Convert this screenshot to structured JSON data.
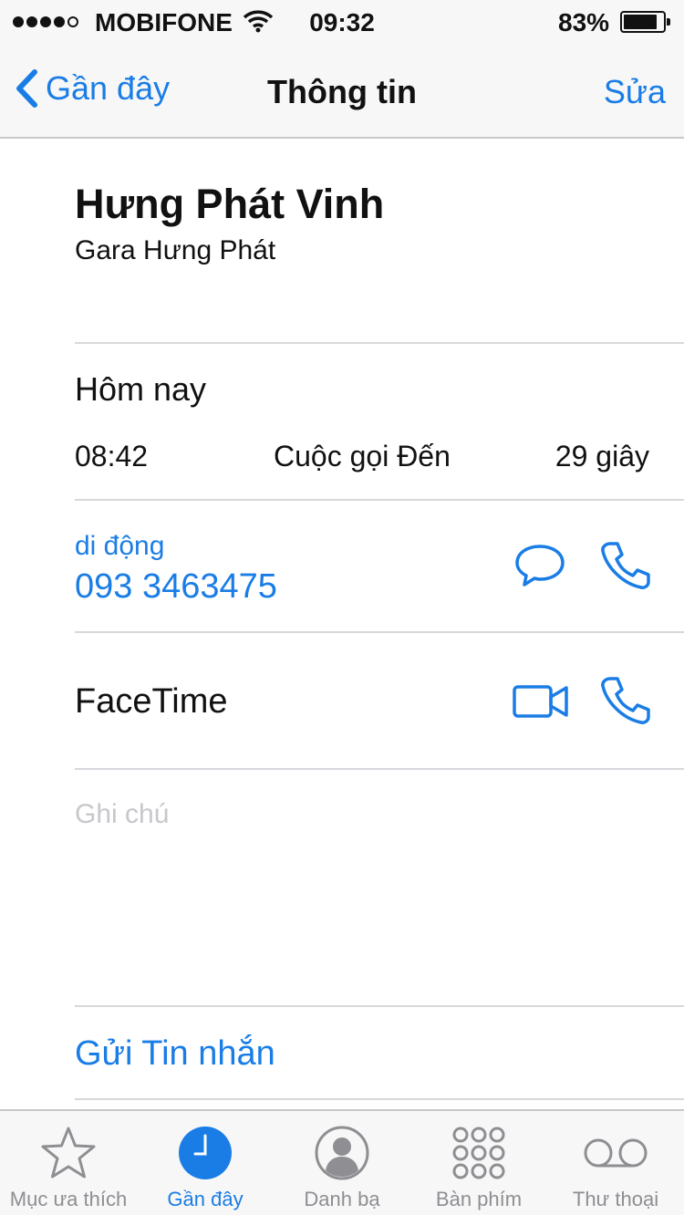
{
  "status_bar": {
    "carrier": "MOBIFONE",
    "time": "09:32",
    "battery_percent": "83%"
  },
  "nav_bar": {
    "back_label": "Gần đây",
    "title": "Thông tin",
    "edit_label": "Sửa"
  },
  "contact": {
    "name": "Hưng Phát Vinh",
    "company": "Gara Hưng Phát"
  },
  "recent_calls": {
    "heading": "Hôm nay",
    "items": [
      {
        "time": "08:42",
        "type": "Cuộc gọi Đến",
        "duration": "29 giây"
      }
    ]
  },
  "phone": {
    "label": "di động",
    "number": "093 3463475"
  },
  "facetime": {
    "label": "FaceTime"
  },
  "notes": {
    "placeholder": "Ghi chú"
  },
  "actions": {
    "send_message": "Gửi Tin nhắn"
  },
  "tab_bar": {
    "items": [
      {
        "label": "Mục ưa thích",
        "icon": "star-icon"
      },
      {
        "label": "Gần đây",
        "icon": "clock-icon",
        "active": true
      },
      {
        "label": "Danh bạ",
        "icon": "contacts-icon"
      },
      {
        "label": "Bàn phím",
        "icon": "keypad-icon"
      },
      {
        "label": "Thư thoại",
        "icon": "voicemail-icon"
      }
    ]
  },
  "colors": {
    "accent": "#1a7de6",
    "inactive": "#8e8e93",
    "placeholder": "#c7c7cc"
  }
}
